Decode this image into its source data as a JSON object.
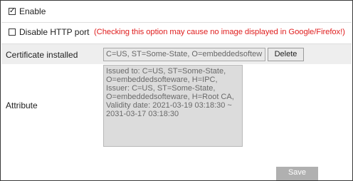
{
  "enable": {
    "label": "Enable",
    "checked": true
  },
  "disable_http": {
    "label": "Disable HTTP port",
    "checked": false,
    "warning": "(Checking this option may cause no image displayed in Google/Firefox!)"
  },
  "certificate": {
    "label": "Certificate installed",
    "value": "C=US, ST=Some-State, O=embeddedsoftew",
    "delete_label": "Delete"
  },
  "attribute": {
    "label": "Attribute",
    "lines": [
      "Issued to: C=US, ST=Some-State,",
      "O=embeddedsofteware, H=IPC,",
      "Issuer: C=US, ST=Some-State,",
      "O=embeddedsofteware, H=Root CA,",
      "Validity date: 2021-03-19 03:18:30 ~",
      "2031-03-17 03:18:30"
    ]
  },
  "save_label": "Save",
  "colors": {
    "warning": "#e02020",
    "save_button": "#b0b0b0",
    "row_shade": "#eeeeee"
  }
}
